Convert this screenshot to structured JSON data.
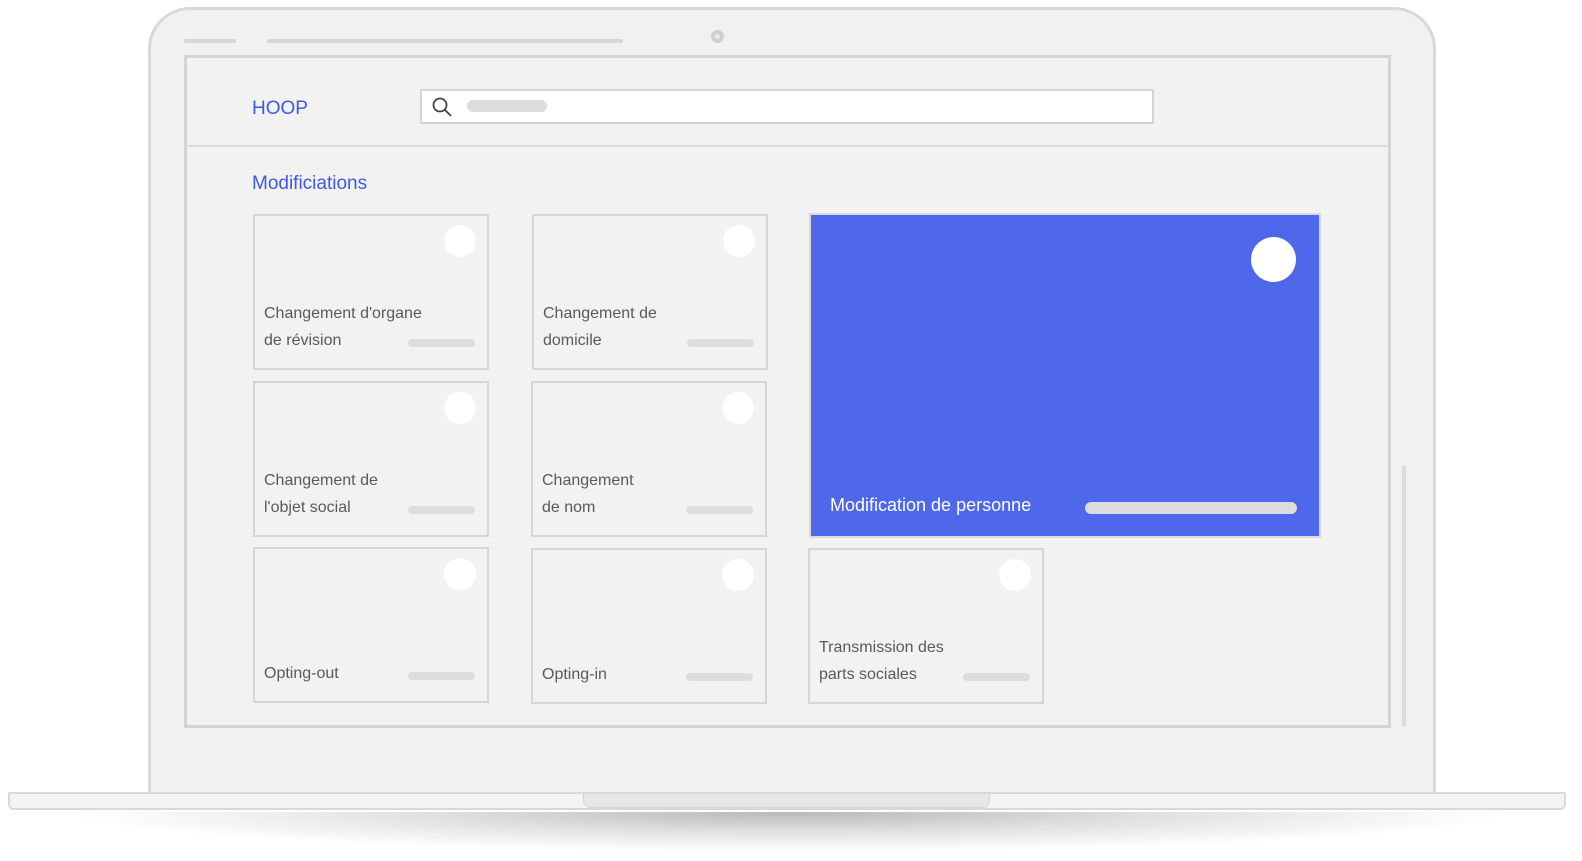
{
  "app": {
    "logo_text": "HOOP"
  },
  "search": {
    "placeholder": ""
  },
  "section": {
    "title": "Modificiations"
  },
  "cards": [
    {
      "label": "Changement d'organe\nde révision"
    },
    {
      "label": "Changement de\ndomicile"
    },
    {
      "label": "Changement de\nl'objet social"
    },
    {
      "label": "Changement\nde nom"
    },
    {
      "label": "Opting-out"
    },
    {
      "label": "Opting-in"
    },
    {
      "label": "Transmission des\nparts sociales"
    }
  ],
  "featured_card": {
    "label": "Modification de personne"
  },
  "colors": {
    "accent": "#3f58e6",
    "featured_bg": "#4f67eb"
  }
}
